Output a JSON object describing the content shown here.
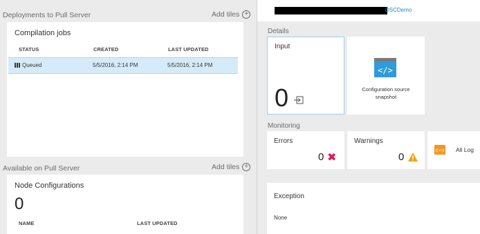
{
  "left": {
    "deployments": {
      "label": "Deployments to Pull Server",
      "add_tiles": "Add tiles",
      "tile_title": "Compilation jobs",
      "columns": [
        "STATUS",
        "CREATED",
        "LAST UPDATED"
      ],
      "rows": [
        {
          "status": "Queued",
          "created": "5/5/2016, 2:14 PM",
          "updated": "5/5/2016, 2:14 PM"
        }
      ]
    },
    "available": {
      "label": "Available on Pull Server",
      "add_tiles": "Add tiles",
      "tile_title": "Node Configurations",
      "count": "0",
      "columns": [
        "NAME",
        "LAST UPDATED"
      ]
    }
  },
  "right": {
    "header": {
      "configuration_value": "DSCDemo"
    },
    "details_label": "Details",
    "input_tile": {
      "title": "Input",
      "value": "0"
    },
    "config_snapshot": {
      "label": "Configuration source snapshot"
    },
    "monitoring_label": "Monitoring",
    "errors_tile": {
      "title": "Errors",
      "value": "0"
    },
    "warnings_tile": {
      "title": "Warnings",
      "value": "0"
    },
    "logs_tile": {
      "label": "All Log"
    },
    "exception_tile": {
      "title": "Exception",
      "value": "None"
    }
  },
  "colors": {
    "accent_blue": "#1a8ad0",
    "selected_row": "#d6ebf9",
    "error_red": "#e81157",
    "warning_orange": "#f0a30a",
    "logs_orange": "#f7941d"
  }
}
